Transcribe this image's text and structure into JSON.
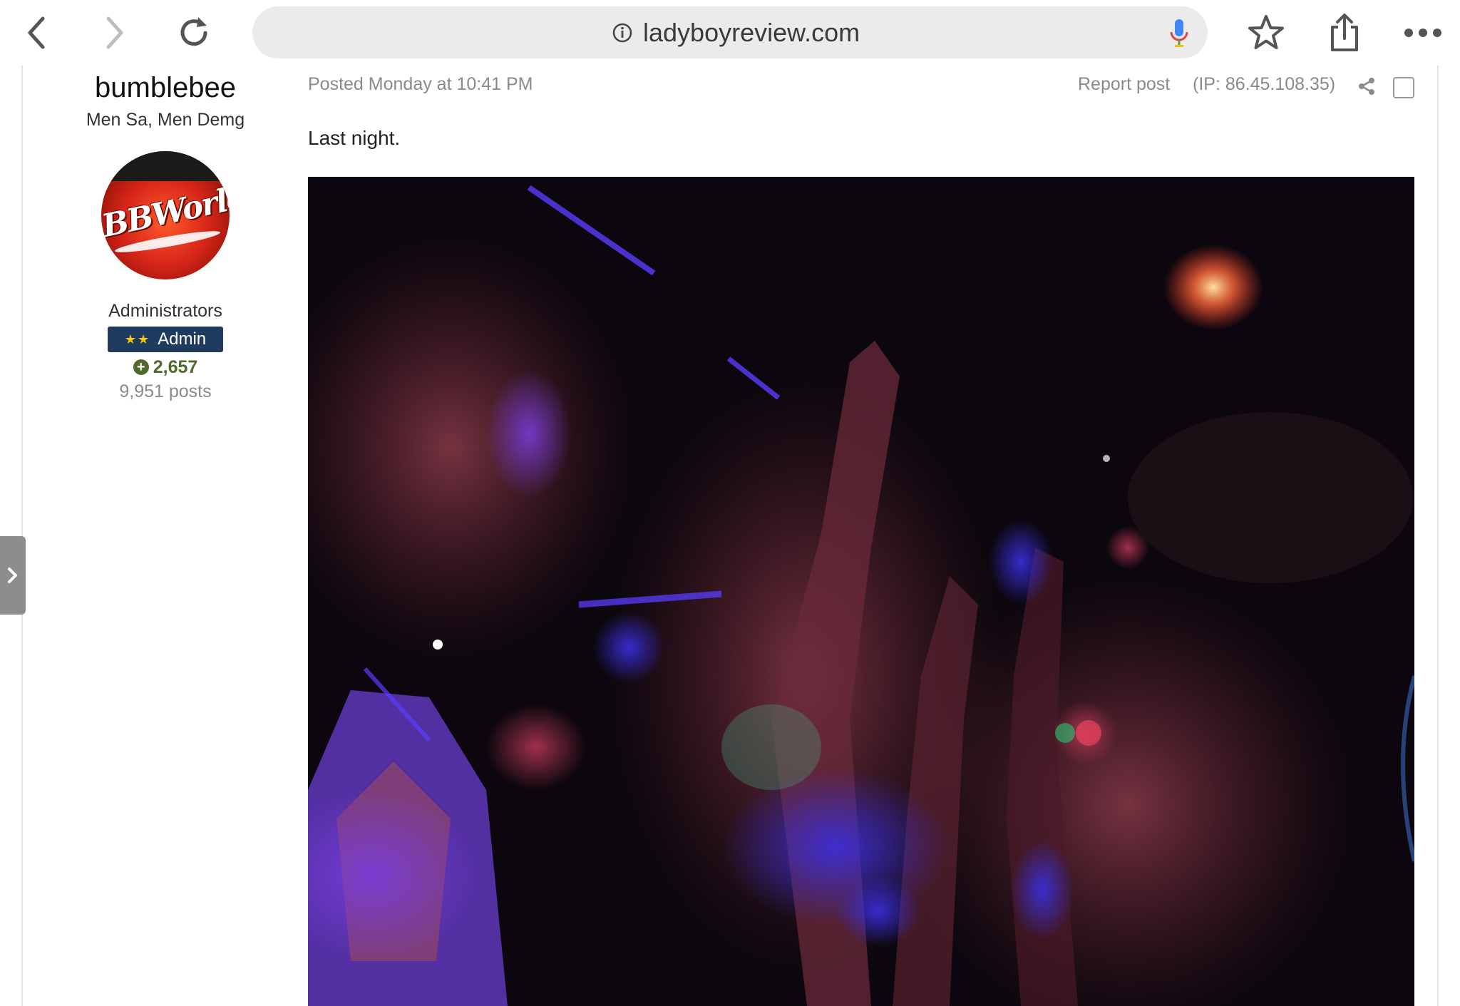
{
  "browser": {
    "url": "ladyboyreview.com",
    "icons": [
      "back-icon",
      "forward-icon",
      "reload-icon",
      "info-icon",
      "mic-icon",
      "bookmark-star-icon",
      "share-icon",
      "more-icon"
    ]
  },
  "author": {
    "name": "bumblebee",
    "title": "Men Sa, Men Demg",
    "avatar_text": "BBWorld",
    "group": "Administrators",
    "badge_label": "Admin",
    "badge_stars": "★★",
    "reputation": "2,657",
    "posts": "9,951 posts"
  },
  "post": {
    "posted": "Posted Monday at 10:41 PM",
    "report": "Report post",
    "ip": "(IP: 86.45.108.35)",
    "text": "Last night."
  },
  "colors": {
    "badge_bg": "#1f3b5e",
    "reputation": "#4f6b2b",
    "meta_text": "#8a8a8a",
    "mic_blue": "#4285f4"
  }
}
